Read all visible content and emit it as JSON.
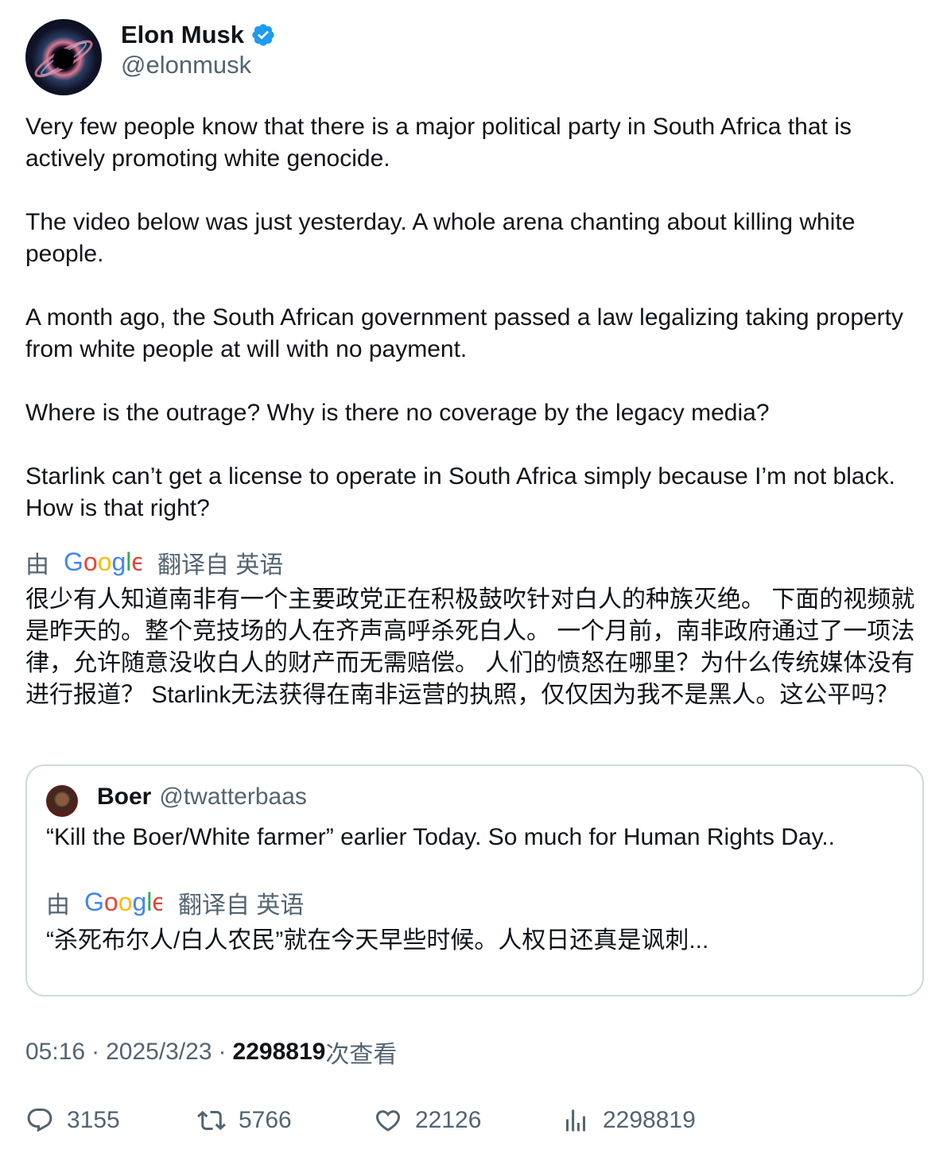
{
  "author": {
    "name": "Elon Musk",
    "handle": "@elonmusk"
  },
  "tweet": {
    "paragraphs": [
      "Very few people know that there is a major political party in South Africa that is actively promoting white genocide.",
      "The video below was just yesterday. A whole arena chanting about killing white people.",
      "A month ago, the South African government passed a law legalizing taking property from white people at will with no payment.",
      "Where is the outrage? Why is there no coverage by the legacy media?",
      "Starlink can’t get a license to operate in South Africa simply because I’m not black. How is that right?"
    ],
    "translation_label_by": "由",
    "translation_label_from": "翻译自 英语",
    "translated_text": "很少有人知道南非有一个主要政党正在积极鼓吹针对白人的种族灭绝。 下面的视频就是昨天的。整个竞技场的人在齐声高呼杀死白人。 一个月前，南非政府通过了一项法律，允许随意没收白人的财产而无需赔偿。 人们的愤怒在哪里？为什么传统媒体没有进行报道？ Starlink无法获得在南非运营的执照，仅仅因为我不是黑人。这公平吗？"
  },
  "quote": {
    "name": "Boer",
    "handle": "@twatterbaas",
    "text": "“Kill the Boer/White farmer” earlier Today. So much for Human Rights Day..",
    "translation_label_by": "由",
    "translation_label_from": "翻译自 英语",
    "translated_text": "“杀死布尔人/白人农民”就在今天早些时候。人权日还真是讽刺..."
  },
  "meta": {
    "time": "05:16",
    "separator": "·",
    "date": "2025/3/23",
    "views_count": "2298819",
    "views_label": "次查看"
  },
  "actions": {
    "replies": "3155",
    "retweets": "5766",
    "likes": "22126",
    "views": "2298819"
  },
  "colors": {
    "text": "#0f1419",
    "secondary": "#536471",
    "border": "#cfd9de",
    "verified": "#1d9bf0"
  }
}
